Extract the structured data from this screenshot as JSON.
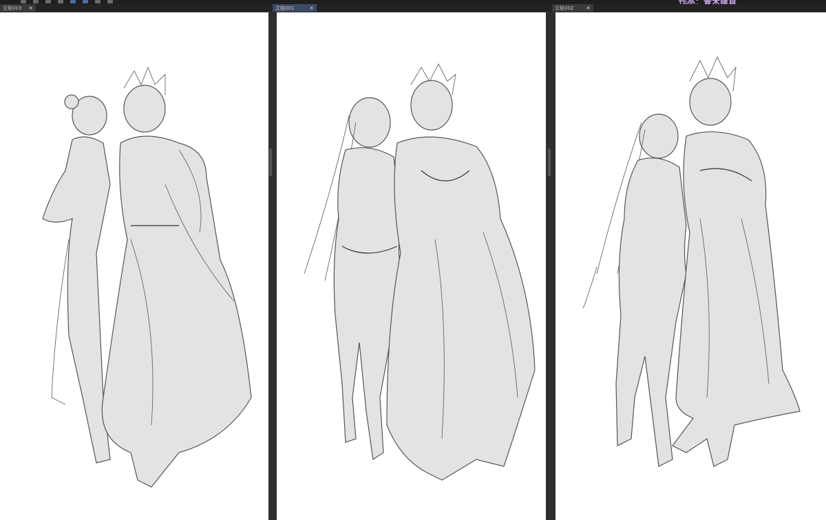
{
  "credit": {
    "text": "作品：青木建貞"
  },
  "panels": [
    {
      "tab_label": "立绘003",
      "close": "×"
    },
    {
      "tab_label": "立绘001",
      "close": "×"
    },
    {
      "tab_label": "立绘002",
      "close": "×"
    }
  ],
  "colors": {
    "background": "#2b2b2b",
    "canvas": "#ffffff",
    "active_tab": "#3e4a63",
    "credit": "#c9a4e6"
  }
}
